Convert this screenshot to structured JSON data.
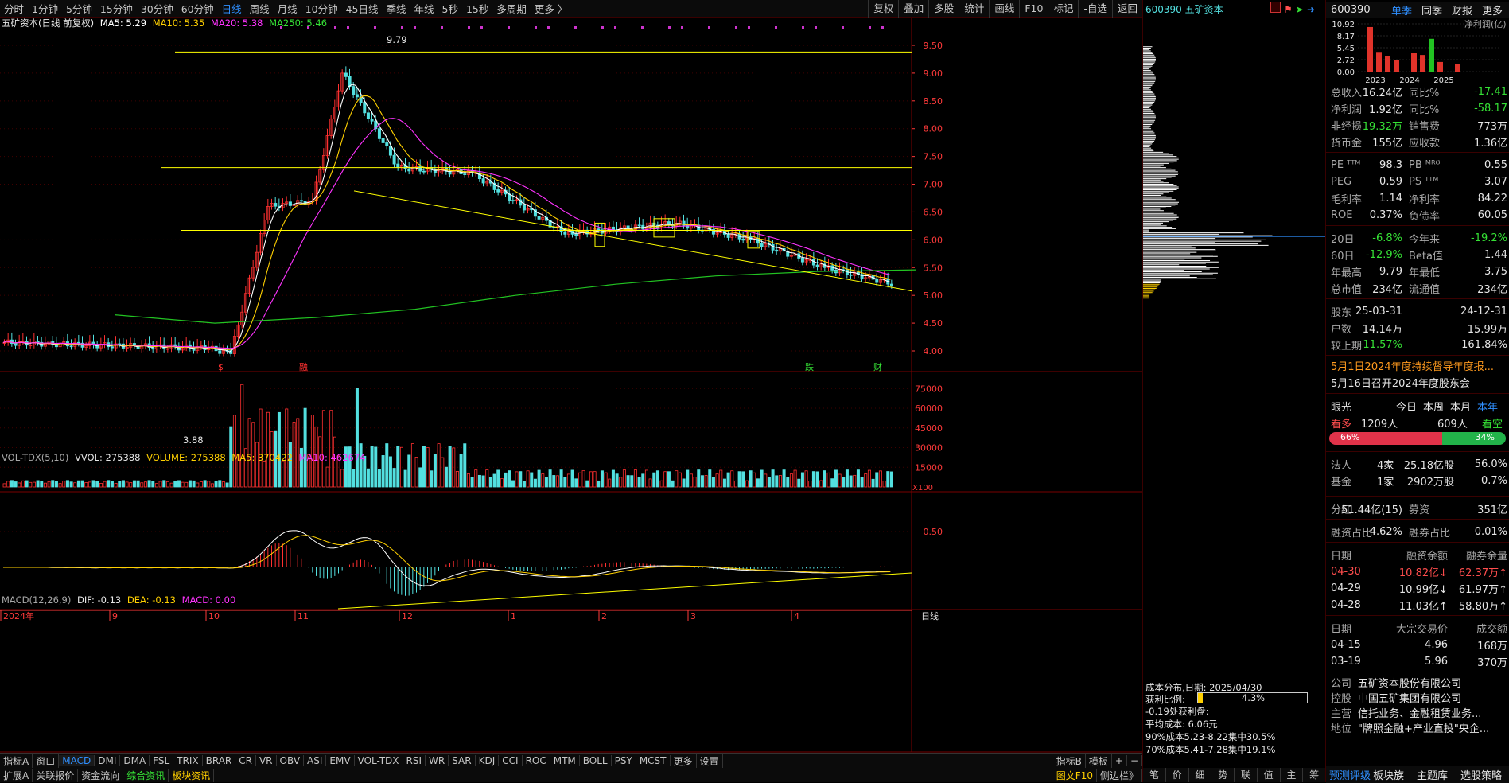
{
  "toolbar": {
    "periods": [
      "分时",
      "1分钟",
      "5分钟",
      "15分钟",
      "30分钟",
      "60分钟",
      "日线",
      "周线",
      "月线",
      "10分钟",
      "45日线",
      "季线",
      "年线",
      "5秒",
      "15秒",
      "多周期",
      "更多 〉"
    ],
    "active": "日线",
    "right": [
      "复权",
      "叠加",
      "多股",
      "统计",
      "画线",
      "F10",
      "标记",
      "-自选",
      "返回"
    ]
  },
  "main": {
    "title": "五矿资本(日线 前复权)",
    "ma5": "MA5: 5.29",
    "ma10": "MA10: 5.35",
    "ma20": "MA20: 5.38",
    "ma250": "MA250: 5.46",
    "high_label": "9.79",
    "low_label": "3.88",
    "price_ticks": [
      "9.50",
      "9.00",
      "8.50",
      "8.00",
      "7.50",
      "7.00",
      "6.50",
      "6.00",
      "5.50",
      "5.00",
      "4.50",
      "4.00"
    ],
    "markers": [
      "$",
      "融",
      "跌",
      "财"
    ]
  },
  "volume": {
    "label": "VOL-TDX(5,10)",
    "vvol": "VVOL: 275388",
    "volume": "VOLUME: 275388",
    "ma5": "MA5: 370422",
    "ma10": "MA10: 462674",
    "ticks": [
      "75000",
      "60000",
      "45000",
      "30000",
      "15000"
    ],
    "unit": "X100"
  },
  "macd": {
    "label": "MACD(12,26,9)",
    "dif": "DIF: -0.13",
    "dea": "DEA: -0.13",
    "macd": "MACD: 0.00",
    "ticks": [
      "0.50"
    ]
  },
  "xaxis": {
    "labels": [
      "2024年",
      "9",
      "10",
      "11",
      "12",
      "1",
      "2",
      "3",
      "4"
    ],
    "period": "日线"
  },
  "tabs1": [
    "指标A",
    "窗口",
    "MACD",
    "DMI",
    "DMA",
    "FSL",
    "TRIX",
    "BRAR",
    "CR",
    "VR",
    "OBV",
    "ASI",
    "EMV",
    "VOL-TDX",
    "RSI",
    "WR",
    "SAR",
    "KDJ",
    "CCI",
    "ROC",
    "MTM",
    "BOLL",
    "PSY",
    "MCST",
    "更多",
    "设置"
  ],
  "tabs1_active": "MACD",
  "tabs1_right": [
    "指标B",
    "模板",
    "+",
    "−"
  ],
  "tabs2": [
    "扩展A",
    "关联报价",
    "资金流向",
    "综合资讯",
    "板块资讯"
  ],
  "tabs2_right": [
    "图文F10",
    "侧边栏》"
  ],
  "cost": {
    "code": "600390",
    "name": "五矿资本",
    "date": "成本分布,日期: 2025/04/30",
    "profit_label": "获利比例:",
    "profit_pct": "4.3%",
    "profit_line": "-0.19处获利盘:",
    "avg_cost": "平均成本: 6.06元",
    "c90": "90%成本5.23-8.22集中30.5%",
    "c70": "70%成本5.41-7.28集中19.1%",
    "bottom_tabs": [
      "笔",
      "价",
      "细",
      "势",
      "联",
      "值",
      "主",
      "筹"
    ]
  },
  "side": {
    "code": "600390",
    "tabs": [
      "单季",
      "同季",
      "财报",
      "更多"
    ],
    "finchart": {
      "ticks": [
        "10.92",
        "8.17",
        "5.45",
        "2.72",
        "0.00"
      ],
      "legend": "净利润(亿)",
      "years": [
        "2023",
        "2024",
        "2025"
      ]
    },
    "fin": [
      [
        "总收入",
        "16.24亿",
        "同比%",
        "-17.41"
      ],
      [
        "净利润",
        "1.92亿",
        "同比%",
        "-58.17"
      ],
      [
        "非经损",
        "-19.32万",
        "销售费",
        "773万"
      ],
      [
        "货币金",
        "155亿",
        "应收款",
        "1.36亿"
      ]
    ],
    "val": [
      [
        "PE ᵀᵀᴹ",
        "98.3",
        "PB ᴹᴿᴽ",
        "0.55"
      ],
      [
        "PEG",
        "0.59",
        "PS ᵀᵀᴹ",
        "3.07"
      ],
      [
        "毛利率",
        "1.14",
        "净利率",
        "84.22"
      ],
      [
        "ROE",
        "0.37%",
        "负债率",
        "60.05"
      ]
    ],
    "perf": [
      [
        "20日",
        "-6.8%",
        "今年来",
        "-19.2%"
      ],
      [
        "60日",
        "-12.9%",
        "Beta值",
        "1.44"
      ],
      [
        "年最高",
        "9.79",
        "年最低",
        "3.75"
      ],
      [
        "总市值",
        "234亿",
        "流通值",
        "234亿"
      ]
    ],
    "holders": [
      [
        "股东",
        "25-03-31",
        "",
        "24-12-31"
      ],
      [
        "户数",
        "14.14万",
        "",
        "15.99万"
      ],
      [
        "较上期",
        "-11.57%",
        "",
        "161.84%"
      ]
    ],
    "news": [
      "5月1日2024年度持续督导年度报...",
      "5月16日召开2024年度股东会"
    ],
    "eye": {
      "label": "眼光",
      "tabs": [
        "今日",
        "本周",
        "本月",
        "本年"
      ],
      "bull": "看多",
      "bull_n": "1209人",
      "bear_n": "609人",
      "bear": "看空",
      "bull_pct": "66%",
      "bear_pct": "34%"
    },
    "inst": [
      [
        "法人",
        "4家",
        "25.18亿股",
        "56.0%"
      ],
      [
        "基金",
        "1家",
        "2902万股",
        "0.7%"
      ]
    ],
    "div": [
      "分红",
      "51.44亿(15)",
      "募资",
      "351亿"
    ],
    "margin_ratio": [
      "融资占比",
      "4.62%",
      "融券占比",
      "0.01%"
    ],
    "margin_head": [
      "日期",
      "融资余额",
      "融券余量"
    ],
    "margin": [
      [
        "04-30",
        "10.82亿↓",
        "62.37万↑"
      ],
      [
        "04-29",
        "10.99亿↓",
        "61.97万↑"
      ],
      [
        "04-28",
        "11.03亿↑",
        "58.80万↑"
      ]
    ],
    "block_head": [
      "日期",
      "大宗交易价",
      "成交额"
    ],
    "block": [
      [
        "04-15",
        "4.96",
        "168万"
      ],
      [
        "03-19",
        "5.96",
        "370万"
      ]
    ],
    "company": [
      [
        "公司",
        "五矿资本股份有限公司"
      ],
      [
        "控股",
        "中国五矿集团有限公司"
      ],
      [
        "主营",
        "信托业务、金融租赁业务..."
      ],
      [
        "地位",
        "\"牌照金融+产业直投\"央企..."
      ]
    ],
    "bottom": [
      "预测评级",
      "板块族",
      "主题库",
      "选股策略"
    ]
  },
  "chart_data": {
    "type": "candlestick",
    "series": [
      {
        "name": "MA250",
        "points": [
          [
            0,
            4.65
          ],
          [
            30,
            4.5
          ],
          [
            60,
            4.6
          ],
          [
            90,
            4.75
          ],
          [
            120,
            5.0
          ],
          [
            150,
            5.2
          ],
          [
            180,
            5.35
          ],
          [
            210,
            5.43
          ],
          [
            240,
            5.46
          ]
        ]
      }
    ],
    "ohlc_sample": {
      "start": 4.1,
      "peak": 9.79,
      "low": 3.88,
      "end": 5.22
    }
  }
}
